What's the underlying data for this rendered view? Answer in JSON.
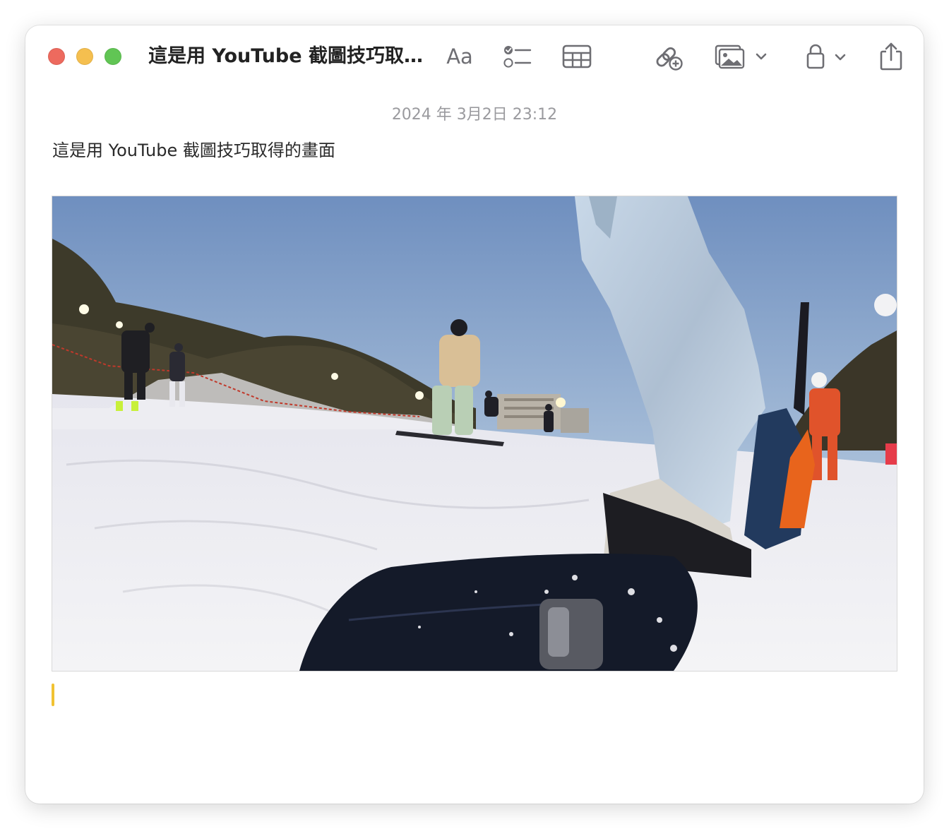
{
  "window": {
    "title": "這是用 YouTube 截圖技巧取得的畫面",
    "traffic_lights": {
      "close_color": "#ed6a5e",
      "minimize_color": "#f5bf4f",
      "zoom_color": "#61c554"
    }
  },
  "toolbar": {
    "format_label": "Aa",
    "items": [
      {
        "icon": "format-text-icon"
      },
      {
        "icon": "checklist-icon"
      },
      {
        "icon": "table-icon"
      },
      {
        "icon": "collaborate-link-icon"
      },
      {
        "icon": "media-icon"
      },
      {
        "icon": "lock-icon"
      },
      {
        "icon": "share-icon"
      }
    ]
  },
  "note": {
    "timestamp": "2024 年 3月2日 23:12",
    "body_text": "這是用 YouTube 截圖技巧取得的畫面",
    "attachment": {
      "type": "image",
      "depicts": "snowboarding photo"
    }
  },
  "accent": {
    "cursor_color": "#f1c232"
  }
}
